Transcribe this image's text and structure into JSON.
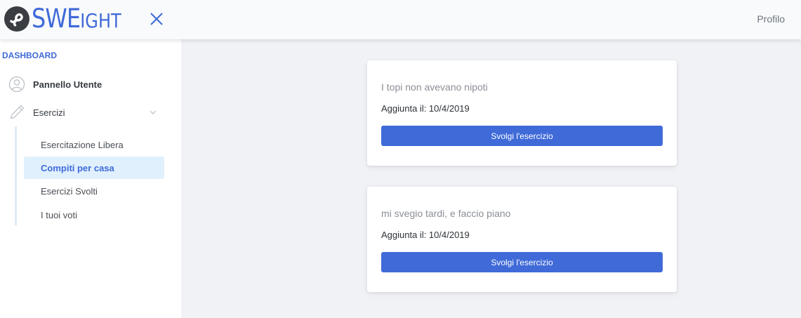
{
  "app": {
    "logo_main": "SWE",
    "logo_tail": "IGHT",
    "logo_icon": "infinity-logo-icon",
    "toggle_icon": "close-icon"
  },
  "header": {
    "profile_label": "Profilo"
  },
  "sidebar": {
    "section_title": "DASHBOARD",
    "items": [
      {
        "label": "Pannello Utente",
        "icon": "user-icon"
      },
      {
        "label": "Esercizi",
        "icon": "pencil-icon",
        "expanded": true
      }
    ],
    "sub_items": [
      {
        "label": "Esercitazione Libera",
        "active": false
      },
      {
        "label": "Compiti per casa",
        "active": true
      },
      {
        "label": "Esercizi Svolti",
        "active": false
      },
      {
        "label": "I tuoi voti",
        "active": false
      }
    ]
  },
  "cards": [
    {
      "title": "I topi non avevano nipoti",
      "date_text": "Aggiunta il: 10/4/2019",
      "button_label": "Svolgi l'esercizio"
    },
    {
      "title": "mi svegio tardi, e faccio piano",
      "date_text": "Aggiunta il: 10/4/2019",
      "button_label": "Svolgi l'esercizio"
    }
  ],
  "colors": {
    "accent": "#3f6ad8",
    "page_bg": "#f0f2f5",
    "active_item_bg": "#e0f0fd"
  }
}
